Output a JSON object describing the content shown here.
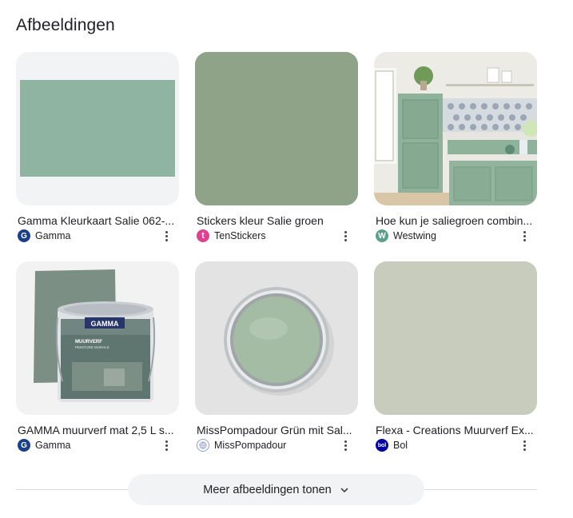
{
  "section_title": "Afbeeldingen",
  "cards": [
    {
      "title": "Gamma Kleurkaart Salie 062-...",
      "source": "Gamma",
      "favicon_letter": "G",
      "favicon_color": "#1a3f8b",
      "image_color": "#8fb4a1",
      "image_name": "salie-paint-swatch"
    },
    {
      "title": "Stickers kleur Salie groen",
      "source": "TenStickers",
      "favicon_letter": "t",
      "favicon_color": "#e0418f",
      "image_color": "#8fa388",
      "image_name": "salie-green-color-block"
    },
    {
      "title": "Hoe kun je saliegroen combin...",
      "source": "Westwing",
      "favicon_letter": "W",
      "favicon_color": "#5aa287",
      "image_color": "#9bba9e",
      "image_name": "sage-green-kitchen-photo"
    },
    {
      "title": "GAMMA muurverf mat 2,5 L s...",
      "source": "Gamma",
      "favicon_letter": "G",
      "favicon_color": "#1a3f8b",
      "image_color": "#7b8f84",
      "image_name": "gamma-paint-can",
      "can_brand": "GAMMA",
      "can_line1": "MUURVERF",
      "can_line2": "PEINTURE MURALE"
    },
    {
      "title": "MissPompadour Grün mit Sal...",
      "source": "MissPompadour",
      "favicon_letter": "",
      "favicon_color": "#8f9ccf",
      "image_color": "#a4bba4",
      "image_name": "open-paint-tin-topview"
    },
    {
      "title": "Flexa - Creations Muurverf Ex...",
      "source": "Bol",
      "favicon_letter": "bol",
      "favicon_color": "#0000a4",
      "image_color": "#c7ccbd",
      "image_name": "flexa-color-block"
    }
  ],
  "more_button": {
    "label": "Meer afbeeldingen tonen"
  }
}
